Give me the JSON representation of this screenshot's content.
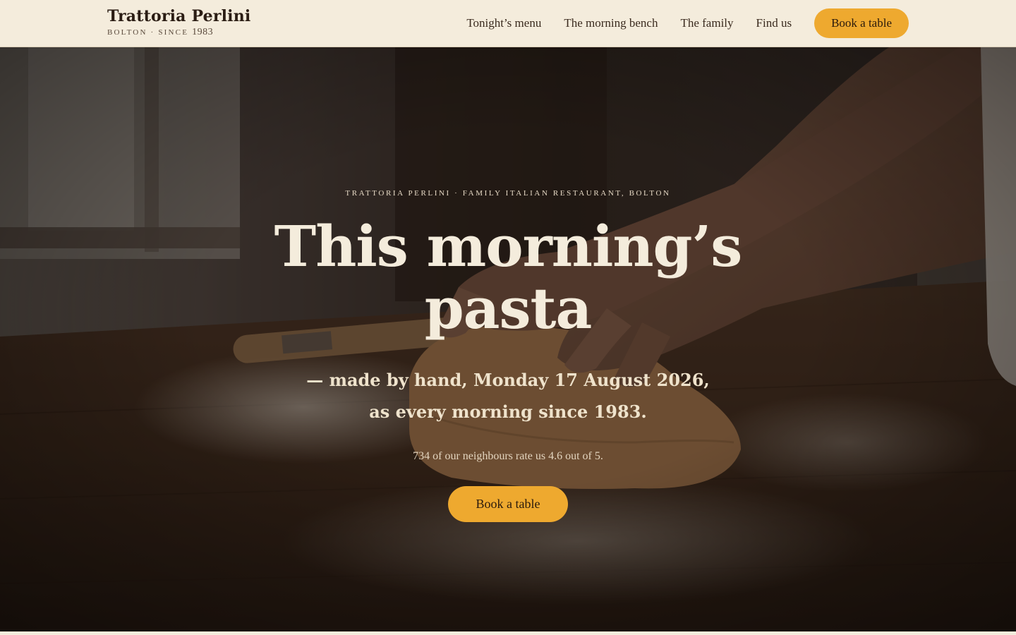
{
  "brand": {
    "name": "Trattoria Perlini",
    "tagline": "BOLTON · SINCE",
    "year": "1983"
  },
  "nav": {
    "links": [
      "Tonight’s menu",
      "The morning bench",
      "The family",
      "Find us"
    ],
    "cta_label": "Book a table"
  },
  "hero": {
    "image_icon": "hands-kneading-dough-photo",
    "eyebrow": "TRATTORIA PERLINI · FAMILY ITALIAN RESTAURANT, BOLTON",
    "title": "This morning’s pasta",
    "subtitle_line1": "— made by hand, Monday 17 August 2026,",
    "subtitle_line2": "as every morning since 1983.",
    "rating_text": "734 of our neighbours rate us 4.6 out of 5.",
    "cta_label": "Book a table"
  },
  "colors": {
    "background": "#f4ecdc",
    "accent": "#eea92f",
    "text_dark": "#2b1d14",
    "hero_text": "#f4ecdc"
  }
}
